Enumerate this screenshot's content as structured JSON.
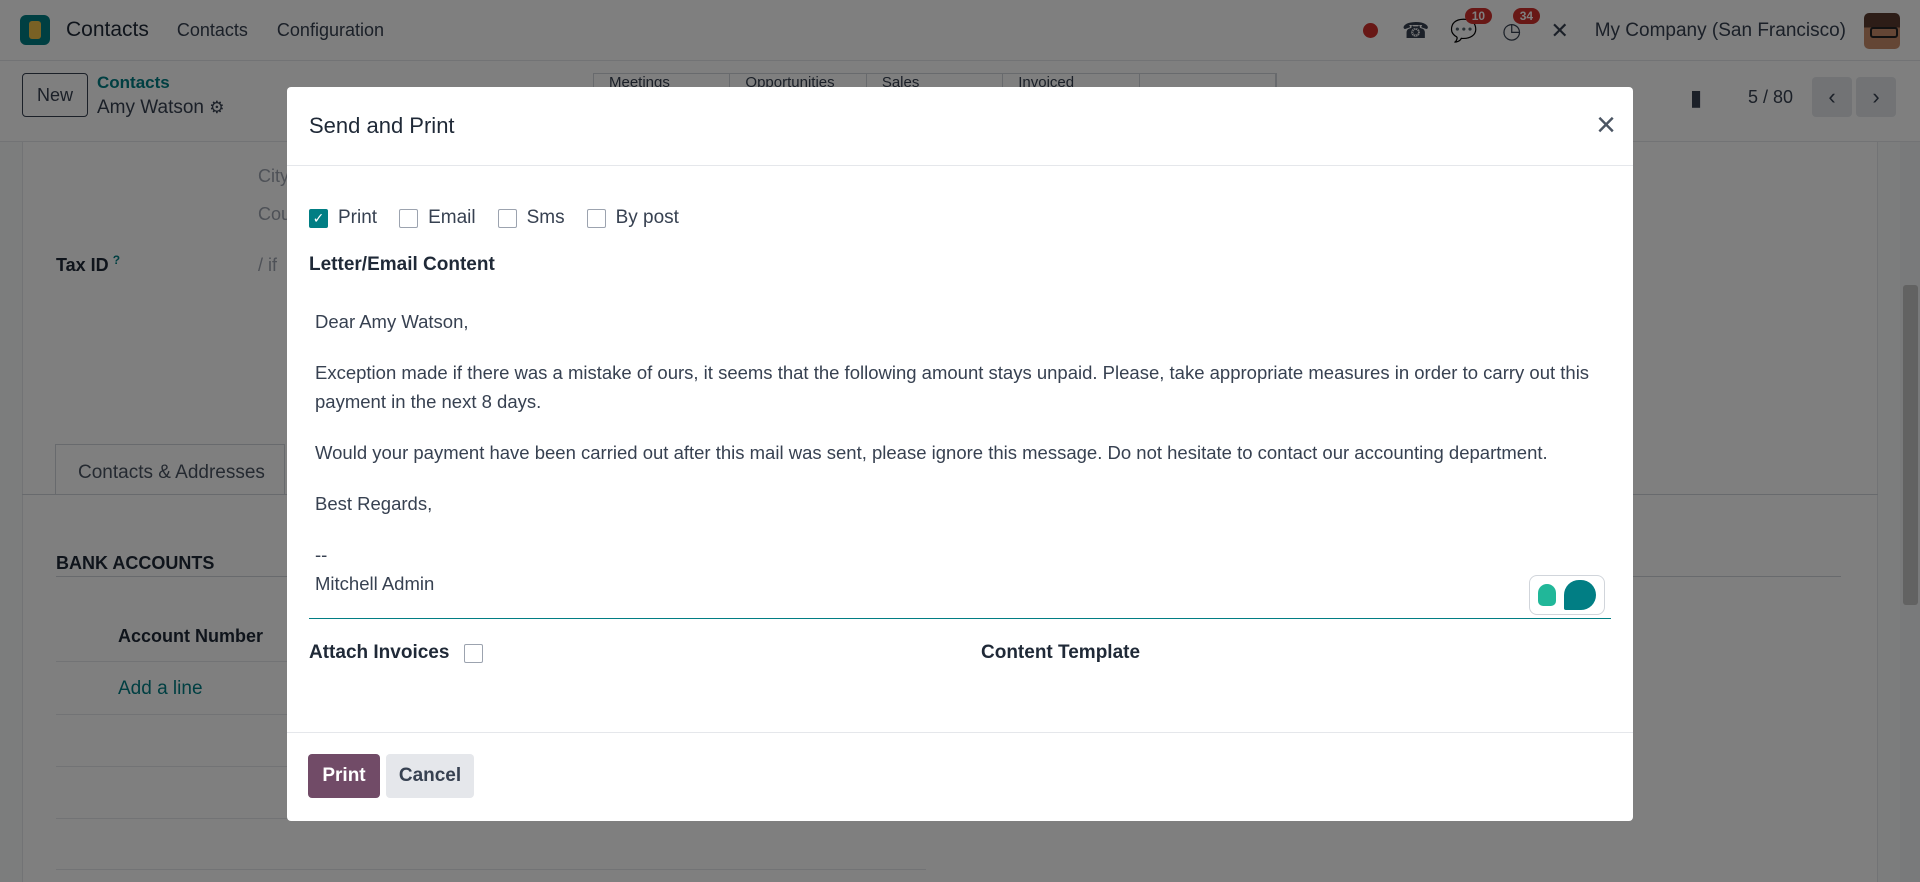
{
  "navbar": {
    "app_name": "Contacts",
    "menu": [
      "Contacts",
      "Configuration"
    ],
    "messages_count": "10",
    "activities_count": "34",
    "company": "My Company (San Francisco)"
  },
  "control": {
    "new_label": "New",
    "breadcrumb_parent": "Contacts",
    "breadcrumb_current": "Amy Watson",
    "stat_buttons": [
      "Meetings",
      "Opportunities",
      "Sales",
      "Invoiced",
      ""
    ],
    "pager": "5 / 80"
  },
  "form": {
    "city_placeholder": "City",
    "country_placeholder": "Cou",
    "tax_id_label": "Tax ID",
    "tax_id_help": "?",
    "tax_id_placeholder": "/ if",
    "tab_label": "Contacts & Addresses",
    "bank_section": "BANK ACCOUNTS",
    "account_number_header": "Account Number",
    "add_line": "Add a line"
  },
  "modal": {
    "title": "Send and Print",
    "options": [
      {
        "label": "Print",
        "checked": true
      },
      {
        "label": "Email",
        "checked": false
      },
      {
        "label": "Sms",
        "checked": false
      },
      {
        "label": "By post",
        "checked": false
      }
    ],
    "content_label": "Letter/Email Content",
    "body": {
      "greeting": "Dear Amy Watson,",
      "para1": "Exception made if there was a mistake of ours, it seems that the following amount stays unpaid. Please, take appropriate measures in order to carry out this payment in the next 8 days.",
      "para2": "Would your payment have been carried out after this mail was sent, please ignore this message. Do not hesitate to contact our accounting department.",
      "closing": "Best Regards,",
      "sig_sep": "--",
      "signature": "Mitchell Admin"
    },
    "attach_label": "Attach Invoices",
    "attach_checked": false,
    "template_label": "Content Template",
    "print_button": "Print",
    "cancel_button": "Cancel"
  },
  "colors": {
    "primary": "#714b67",
    "accent": "#017e84",
    "badge": "#d0312d"
  }
}
